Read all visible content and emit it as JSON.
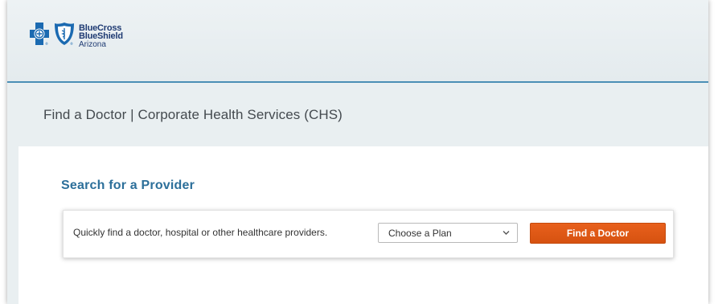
{
  "brand": {
    "line1": "BlueCross",
    "line2": "BlueShield",
    "line3": "Arizona",
    "primary_color": "#1f3b73",
    "accent_color": "#4b8fb6",
    "cross_color": "#1b6ab1"
  },
  "page": {
    "title": "Find a Doctor | Corporate Health Services (CHS)"
  },
  "search": {
    "heading": "Search for a Provider",
    "description": "Quickly find a doctor, hospital or other healthcare providers.",
    "plan_select": {
      "selected": "Choose a Plan",
      "icon": "chevron-down-icon"
    },
    "button_label": "Find a Doctor",
    "button_color": "#e25a17"
  }
}
